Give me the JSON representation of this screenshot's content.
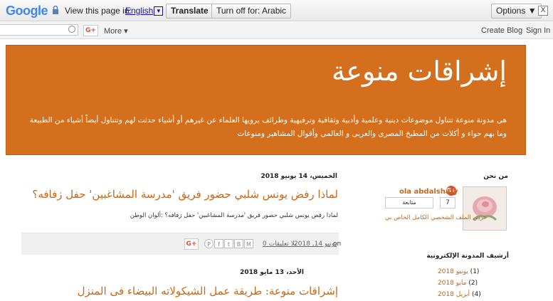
{
  "translate_bar": {
    "logo": "Google",
    "prompt": "View this page in:",
    "language": "English",
    "translate_label": "Translate",
    "turn_off_label": "Turn off for: Arabic",
    "options_label": "Options ▼",
    "close_label": "X"
  },
  "nav_bar": {
    "gplus_label": "G+",
    "more_label": "More ▾",
    "create_blog_label": "Create Blog",
    "sign_in_label": "Sign In"
  },
  "header": {
    "title": "إشراقات منوعة",
    "description": "هى مدونة منوعة تتناول موضوعات دينية وعلمية وأدبية وثقافية وترفيهية وطرائف يرويها العلماء عن غيرهم أو أشياء حدثت لهم وتتناول أيضاً أشياء من الطبيعة وما بهم حواء و أكلات من المطبخ المصرى والعربى و العالمى وأقوال المشاهير ومنوعات"
  },
  "posts": [
    {
      "date": "الخميس، 14 يونيو 2018",
      "title": "لماذا رفض يونس شلبي حضور فريق 'مدرسة المشاغبين' حفل زفافه؟",
      "snippet": "لماذا رفض يونس شلبي حضور فريق 'مدرسة المشاغبين' حفل زفافه؟ :ألوان الوطن",
      "footer": {
        "on_label": "on",
        "date_link": "يونيو 14, 2018",
        "comments_link": "0 بلا تعليقات",
        "gplus_label": "G+"
      }
    },
    {
      "date": "الأحد، 13 مايو 2018",
      "title": "إشراقات منوعة: طريقة عمل الشيكولاته البيضاء فى المنزل"
    }
  ],
  "sidebar": {
    "about_heading": "من نحن",
    "profile_name": "ola abdalshafy",
    "gplus_badge": "G+",
    "follow_label": "متابعة",
    "follower_count": "7",
    "profile_link": "عرض الملف الشخصي الكامل الخاص بي",
    "archive_heading": "أرشيف المدونة الإلكترونية",
    "archive": [
      {
        "month": "يونيو 2018",
        "count": "(1)"
      },
      {
        "month": "مايو 2018",
        "count": "(2)"
      },
      {
        "month": "أبريل 2018",
        "count": "(4)"
      }
    ]
  },
  "colors": {
    "header_bg": "#d46f1e",
    "link_orange": "#cc6611",
    "gplus_red": "#dd4b39"
  }
}
